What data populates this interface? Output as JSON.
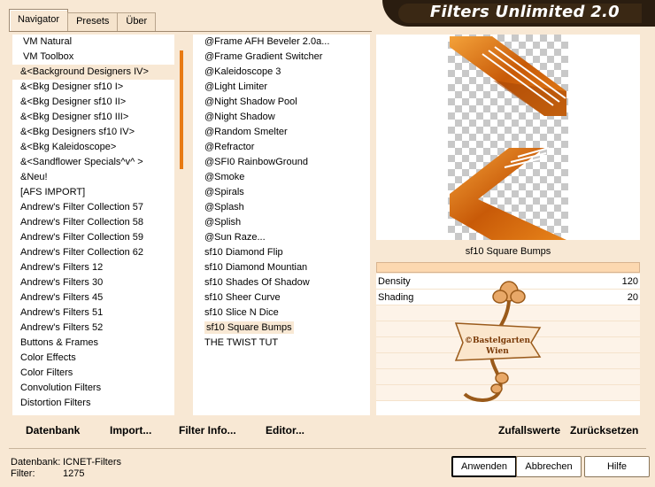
{
  "window": {
    "title": "Filters Unlimited 2.0"
  },
  "tabs": [
    {
      "label": "Navigator",
      "active": true
    },
    {
      "label": "Presets",
      "active": false
    },
    {
      "label": "Über",
      "active": false
    }
  ],
  "categories": [
    "VM Natural",
    "VM Toolbox",
    "&<Background Designers IV>",
    "&<Bkg Designer sf10 I>",
    "&<Bkg Designer sf10 II>",
    "&<Bkg Designer sf10 III>",
    "&<Bkg Designers sf10 IV>",
    "&<Bkg Kaleidoscope>",
    "&<Sandflower Specials^v^ >",
    "&Neu!",
    "[AFS IMPORT]",
    "Andrew's Filter Collection 57",
    "Andrew's Filter Collection 58",
    "Andrew's Filter Collection 59",
    "Andrew's Filter Collection 62",
    "Andrew's Filters 12",
    "Andrew's Filters 30",
    "Andrew's Filters 45",
    "Andrew's Filters 51",
    "Andrew's Filters 52",
    "Buttons & Frames",
    "Color Effects",
    "Color Filters",
    "Convolution Filters",
    "Distortion Filters"
  ],
  "selected_category_index": 2,
  "filters": [
    "@Frame AFH Beveler 2.0a...",
    "@Frame Gradient Switcher",
    "@Kaleidoscope 3",
    "@Light Limiter",
    "@Night Shadow Pool",
    "@Night Shadow",
    "@Random Smelter",
    "@Refractor",
    "@SFI0 RainbowGround",
    "@Smoke",
    "@Spirals",
    "@Splash",
    "@Splish",
    "@Sun Raze...",
    "sf10 Diamond Flip",
    "sf10 Diamond Mountian",
    "sf10 Shades Of Shadow",
    "sf10 Sheer Curve",
    "sf10 Slice N Dice",
    "sf10 Square Bumps",
    "THE TWIST TUT"
  ],
  "selected_filter_index": 19,
  "preview": {
    "filter_name": "sf10 Square Bumps",
    "watermark_line1": "©Bastelgarten",
    "watermark_line2": "Wien"
  },
  "params": [
    {
      "label": "Density",
      "value": "120"
    },
    {
      "label": "Shading",
      "value": "20"
    }
  ],
  "links": {
    "database": "Datenbank",
    "import": "Import...",
    "filter_info": "Filter Info...",
    "editor": "Editor...",
    "random": "Zufallswerte",
    "reset": "Zurücksetzen"
  },
  "status": {
    "database_label": "Datenbank:",
    "database_value": "ICNET-Filters",
    "filter_label": "Filter:",
    "filter_value": "1275"
  },
  "buttons": {
    "apply": "Anwenden",
    "cancel": "Abbrechen",
    "help": "Hilfe"
  },
  "colors": {
    "accent": "#e87a12",
    "background": "#f8e8d4",
    "banner": "#2a1d10"
  }
}
